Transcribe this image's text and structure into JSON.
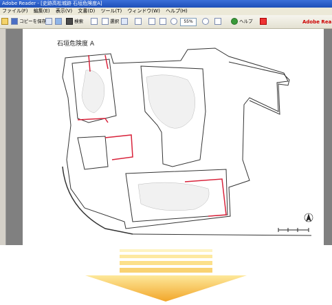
{
  "window": {
    "title": "Adobe Reader - [史跡高松城跡 石垣危険度A]"
  },
  "menu": [
    "ファイル(F)",
    "編集(E)",
    "表示(V)",
    "文書(D)",
    "ツール(T)",
    "ウィンドウ(W)",
    "ヘルプ(H)"
  ],
  "toolbar": {
    "save_copy_label": "コピーを保存",
    "search_label": "検索",
    "select_label": "選択",
    "zoom_value": "55%",
    "help_label": "ヘルプ",
    "brand_label": "Adobe Rea"
  },
  "document": {
    "map_title": "石垣危険度 A"
  },
  "colors": {
    "highlight": "#d8223a",
    "arrow_top": "#fde89a",
    "arrow_bottom": "#f2a62a"
  }
}
